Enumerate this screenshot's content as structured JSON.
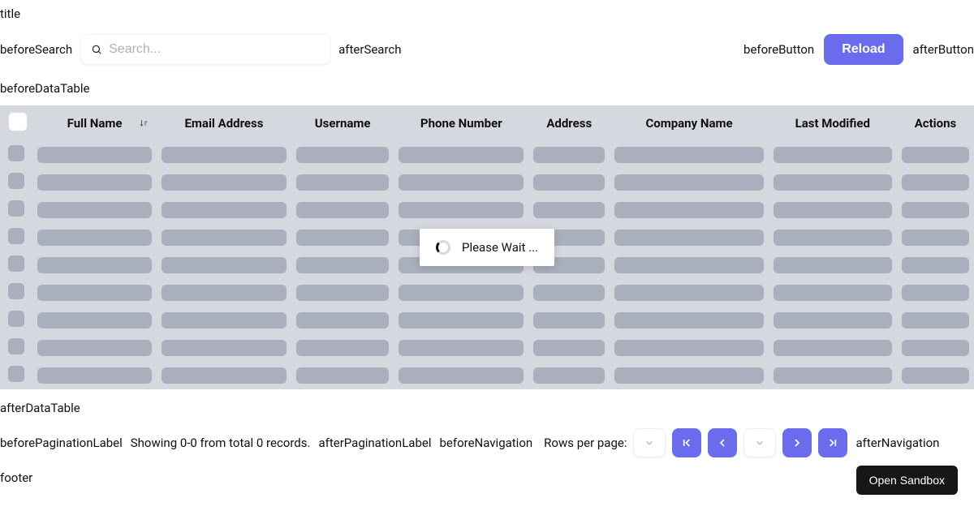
{
  "slots": {
    "title": "title",
    "beforeSearch": "beforeSearch",
    "afterSearch": "afterSearch",
    "beforeButton": "beforeButton",
    "afterButton": "afterButton",
    "beforeDataTable": "beforeDataTable",
    "afterDataTable": "afterDataTable",
    "beforePaginationLabel": "beforePaginationLabel",
    "afterPaginationLabel": "afterPaginationLabel",
    "beforeNavigation": "beforeNavigation",
    "afterNavigation": "afterNavigation",
    "footer": "footer"
  },
  "search": {
    "placeholder": "Search...",
    "value": ""
  },
  "toolbar": {
    "reload_label": "Reload"
  },
  "table": {
    "columns": {
      "full_name": "Full Name",
      "email": "Email Address",
      "username": "Username",
      "phone": "Phone Number",
      "address": "Address",
      "company": "Company Name",
      "modified": "Last Modified",
      "actions": "Actions"
    },
    "loading_text": "Please Wait ...",
    "skeleton_row_count": 9
  },
  "pagination": {
    "label": "Showing 0-0 from total 0 records.",
    "rows_per_page_label": "Rows per page:",
    "rows_per_page_value": "",
    "current_page_value": ""
  },
  "sandbox": {
    "label": "Open Sandbox"
  }
}
